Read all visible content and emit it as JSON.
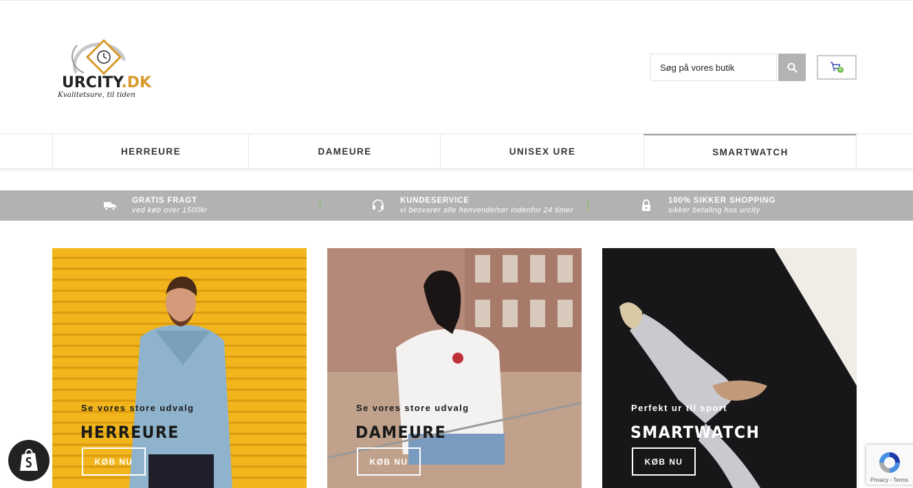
{
  "header": {
    "logo_text_main": "URCITY",
    "logo_text_dot": ".DK",
    "logo_tagline": "Kvalitetsure, til tiden",
    "search_placeholder": "Søg på vores butik",
    "cart_count": "0"
  },
  "nav": {
    "items": [
      {
        "label": "HERREURE"
      },
      {
        "label": "DAMEURE"
      },
      {
        "label": "UNISEX URE"
      },
      {
        "label": "SMARTWATCH"
      }
    ]
  },
  "usp": [
    {
      "icon": "truck-icon",
      "title": "GRATIS FRAGT",
      "subtitle": "ved køb over 1500kr"
    },
    {
      "icon": "headset-icon",
      "title": "KUNDESERVICE",
      "subtitle": "vi besvarer alle henvendelser indenfor 24 timer"
    },
    {
      "icon": "lock-icon",
      "title": "100% SIKKER SHOPPING",
      "subtitle": "sikker betaling hos urcity"
    }
  ],
  "cards": [
    {
      "subtitle": "Se vores store udvalg",
      "title": "HERREURE",
      "button": "KØB NU",
      "text_color": "#1a1a1a"
    },
    {
      "subtitle": "Se vores store udvalg",
      "title": "DAMEURE",
      "button": "KØB NU",
      "text_color": "#1a1a1a"
    },
    {
      "subtitle": "Perfekt ur til sport",
      "title": "SMARTWATCH",
      "button": "KØB NU",
      "text_color": "#ffffff"
    }
  ],
  "recaptcha": {
    "links": "Privacy - Terms"
  },
  "colors": {
    "usp_bar": "#b2b2b2",
    "logo_orange": "#d79a2b",
    "accent_green": "#6cc04a"
  }
}
